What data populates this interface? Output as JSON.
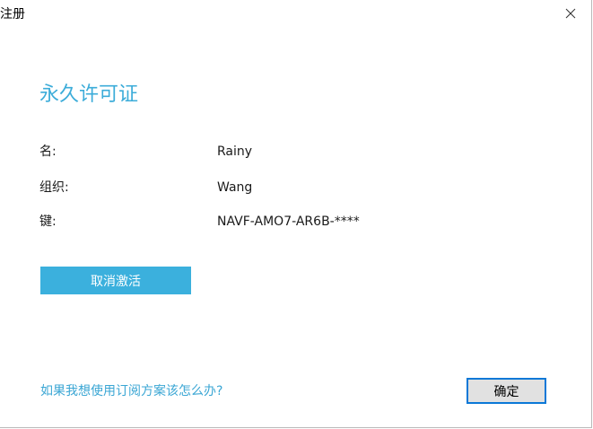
{
  "window": {
    "title": "注册"
  },
  "license": {
    "heading": "永久许可证",
    "rows": [
      {
        "label": "名:",
        "value": "Rainy"
      },
      {
        "label": "组织:",
        "value": "Wang"
      },
      {
        "label": "键:",
        "value": "NAVF-AMO7-AR6B-****"
      }
    ]
  },
  "actions": {
    "deactivate_label": "取消激活",
    "subscription_link": "如果我想使用订阅方案该怎么办?",
    "ok_label": "确定"
  },
  "colors": {
    "accent": "#3bb0dd",
    "heading": "#3cacd9",
    "focus_border": "#0a78d7"
  },
  "icons": {
    "close": "close-icon"
  }
}
